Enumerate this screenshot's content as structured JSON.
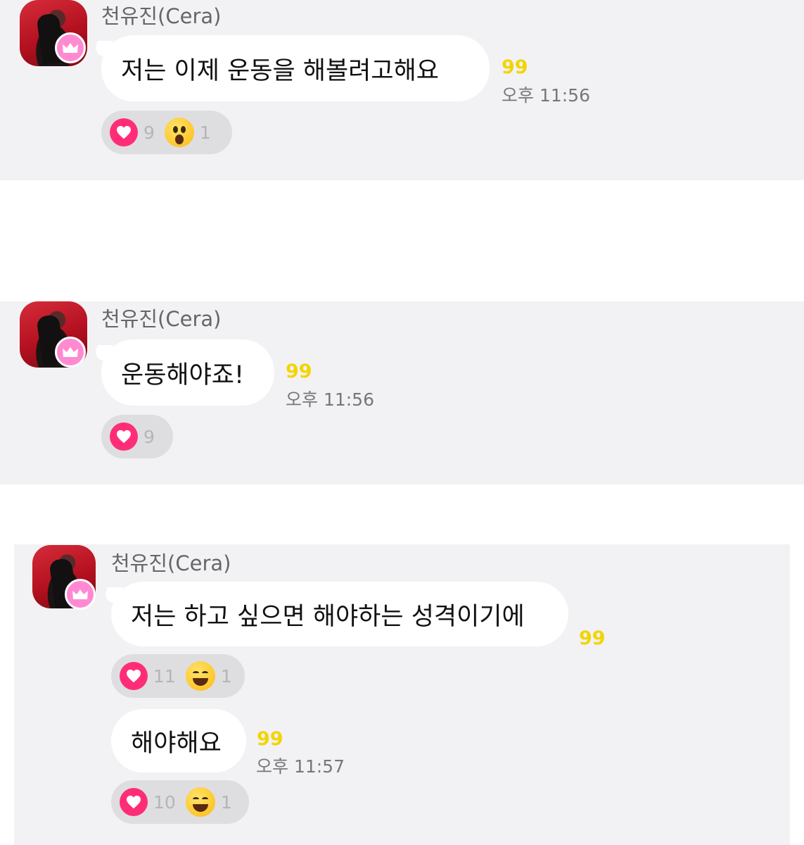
{
  "colors": {
    "card_bg": "#f2f2f4",
    "bubble_bg": "#ffffff",
    "unread": "#f3d400",
    "heart": "#ff2d78",
    "crown": "#ff8ad1"
  },
  "sender": {
    "name": "천유진(Cera)",
    "avatar_icon": "profile-photo",
    "badge_icon": "crown-icon"
  },
  "messages": [
    {
      "text": "저는 이제 운동을 해볼려고해요",
      "unread": "99",
      "time": "오후 11:56",
      "reactions": [
        {
          "icon": "heart-icon",
          "count": "9"
        },
        {
          "icon": "surprised-face-icon",
          "count": "1"
        }
      ]
    },
    {
      "text": "운동해야죠!",
      "unread": "99",
      "time": "오후 11:56",
      "reactions": [
        {
          "icon": "heart-icon",
          "count": "9"
        }
      ]
    },
    {
      "text": "저는 하고 싶으면 해야하는 성격이기에",
      "unread": "99",
      "reactions": [
        {
          "icon": "heart-icon",
          "count": "11"
        },
        {
          "icon": "grinning-face-icon",
          "count": "1"
        }
      ]
    },
    {
      "text": "해야해요",
      "unread": "99",
      "time": "오후 11:57",
      "reactions": [
        {
          "icon": "heart-icon",
          "count": "10"
        },
        {
          "icon": "grinning-face-icon",
          "count": "1"
        }
      ]
    }
  ]
}
